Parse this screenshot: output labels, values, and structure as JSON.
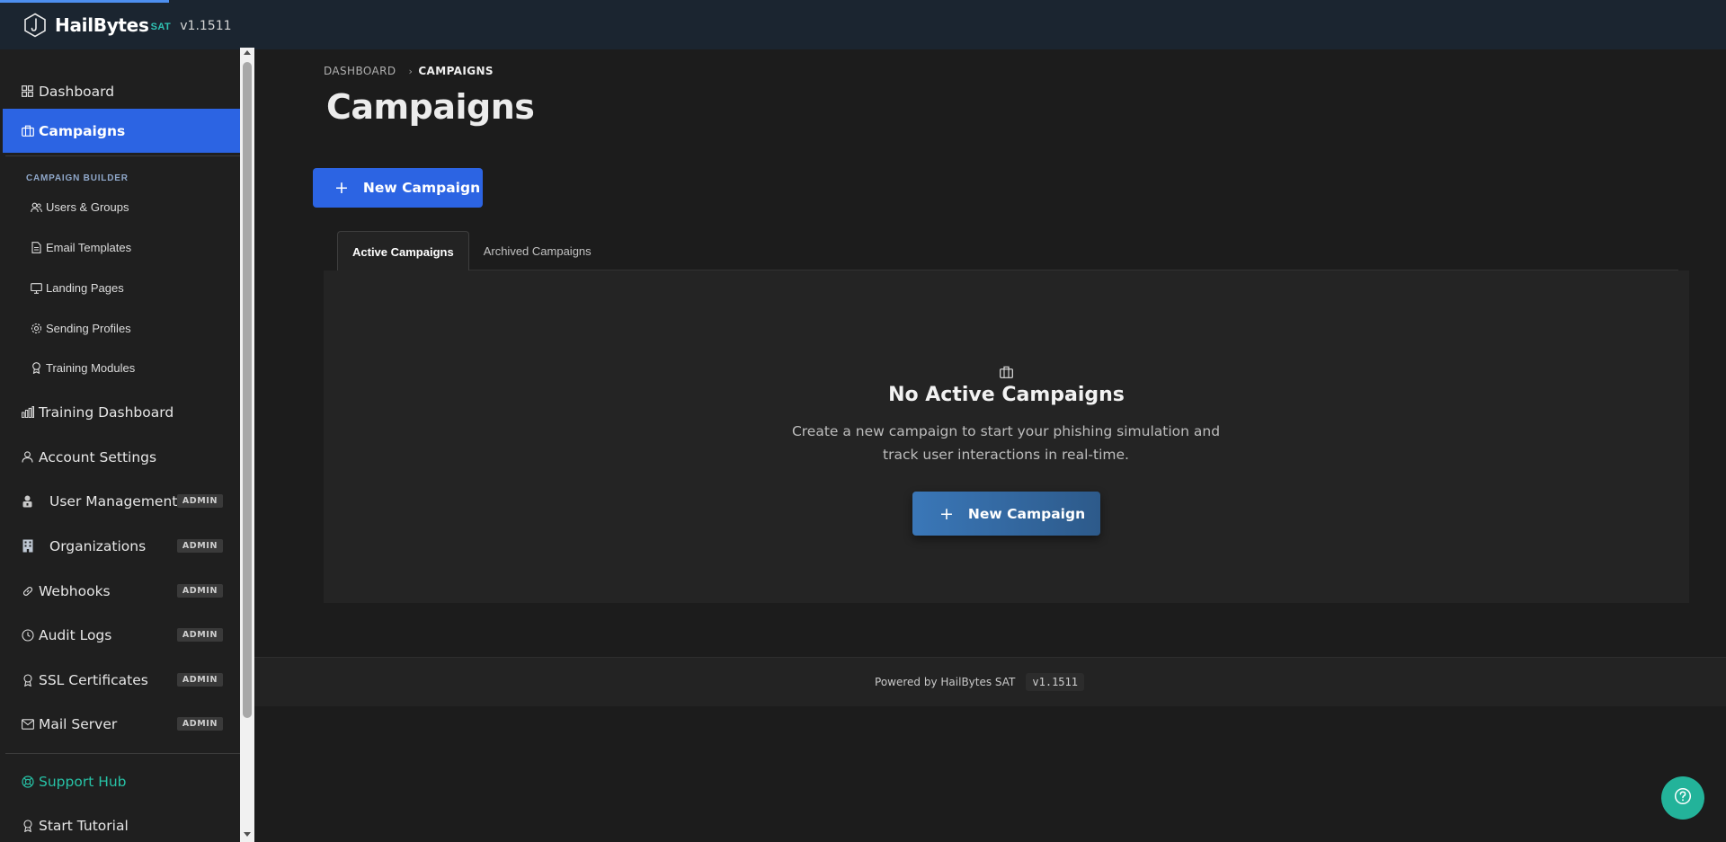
{
  "header": {
    "brand": "HailBytes",
    "brand_suffix": "SAT",
    "version": "v1.1511"
  },
  "sidebar": {
    "items": [
      {
        "label": "Dashboard",
        "icon": "grid-icon"
      },
      {
        "label": "Campaigns",
        "icon": "briefcase-icon",
        "active": true
      }
    ],
    "section_label": "CAMPAIGN BUILDER",
    "sub_items": [
      {
        "label": "Users & Groups",
        "icon": "users-icon"
      },
      {
        "label": "Email Templates",
        "icon": "document-icon"
      },
      {
        "label": "Landing Pages",
        "icon": "monitor-icon"
      },
      {
        "label": "Sending Profiles",
        "icon": "gear-icon"
      },
      {
        "label": "Training Modules",
        "icon": "award-icon"
      }
    ],
    "lower_items": [
      {
        "label": "Training Dashboard",
        "icon": "bar-chart-icon"
      },
      {
        "label": "Account Settings",
        "icon": "user-icon"
      },
      {
        "label": "User Management",
        "icon": "user-lock-icon",
        "badge": "ADMIN"
      },
      {
        "label": "Organizations",
        "icon": "building-icon",
        "badge": "ADMIN"
      },
      {
        "label": "Webhooks",
        "icon": "link-icon",
        "badge": "ADMIN"
      },
      {
        "label": "Audit Logs",
        "icon": "clock-icon",
        "badge": "ADMIN"
      },
      {
        "label": "SSL Certificates",
        "icon": "award-icon",
        "badge": "ADMIN"
      },
      {
        "label": "Mail Server",
        "icon": "mail-icon",
        "badge": "ADMIN"
      }
    ],
    "bottom_items": [
      {
        "label": "Support Hub",
        "icon": "lifebuoy-icon"
      },
      {
        "label": "Start Tutorial",
        "icon": "award-icon"
      }
    ]
  },
  "main": {
    "breadcrumb": [
      "DASHBOARD",
      "CAMPAIGNS"
    ],
    "title": "Campaigns",
    "new_campaign_label": "New Campaign",
    "tabs": [
      {
        "label": "Active Campaigns",
        "active": true
      },
      {
        "label": "Archived Campaigns",
        "active": false
      }
    ],
    "empty_state": {
      "title": "No Active Campaigns",
      "description": "Create a new campaign to start your phishing simulation and track user interactions in real-time.",
      "button_label": "New Campaign"
    }
  },
  "footer": {
    "text": "Powered by HailBytes SAT",
    "version": "v1.1511"
  },
  "colors": {
    "accent": "#2c64e3",
    "teal": "#27c2a6",
    "sidebar_bg": "#1f1f1f",
    "header_bg": "#1b2530"
  }
}
